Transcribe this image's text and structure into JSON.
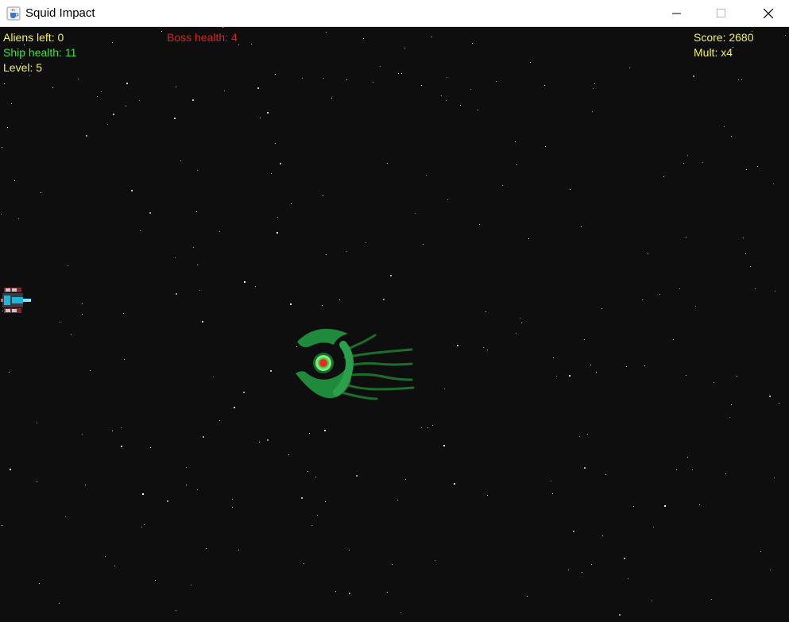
{
  "window": {
    "title": "Squid Impact",
    "app_icon": "java-cup-icon",
    "controls": [
      "minimize-icon",
      "maximize-icon",
      "close-icon"
    ]
  },
  "hud": {
    "aliens_left": "Aliens left: 0",
    "ship_health": "Ship health: 11",
    "level": "Level: 5",
    "boss_health": "Boss health: 4",
    "score": "Score: 2680",
    "mult": "Mult: x4"
  },
  "colors": {
    "background": "#0e0e0e",
    "hud_yellow": "#f2f25a",
    "hud_green": "#3ee03e",
    "hud_red": "#e02020",
    "boss_body": "#1f8a3c",
    "boss_eye": "#ff2020",
    "star": "#ffffff"
  },
  "sprites": {
    "player": "player-ship-sprite",
    "boss": "squid-boss-sprite"
  }
}
